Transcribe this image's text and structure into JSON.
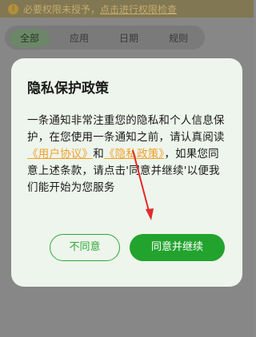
{
  "background": {
    "warning_text": "必要权限未授予，",
    "warning_link": "点击进行权限检查",
    "warning_icon": "warning-icon",
    "tabs": [
      {
        "label": "全部",
        "active": true
      },
      {
        "label": "应用",
        "active": false
      },
      {
        "label": "日期",
        "active": false
      },
      {
        "label": "规则",
        "active": false
      }
    ]
  },
  "dialog": {
    "title": "隐私保护政策",
    "body_before_link1": "一条通知非常注重您的隐私和个人信息保护，在您使用一条通知之前，请认真阅读",
    "link_user_agreement": "《用户协议》",
    "body_and": "和",
    "link_privacy_policy": "《隐私政策》",
    "body_after_links": "，如果您同意上述条款，请点击'同意并继续'以便我们能开始为您服务",
    "disagree_label": "不同意",
    "agree_label": "同意并继续"
  },
  "colors": {
    "primary_green": "#22a32e",
    "link_orange": "#f0a12a",
    "annotation_arrow": "#e02b2b"
  }
}
